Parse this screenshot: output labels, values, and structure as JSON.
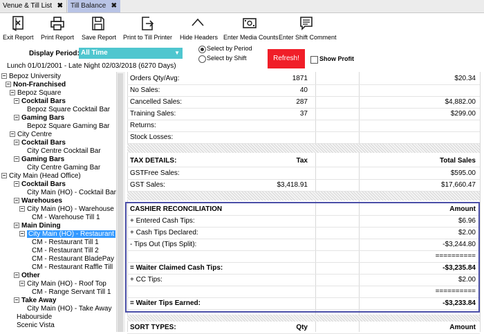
{
  "tabs": [
    {
      "label": "Venue & Till List",
      "close": "✖"
    },
    {
      "label": "Till Balance",
      "close": "✖"
    }
  ],
  "toolbar": {
    "items": [
      {
        "label": "Exit Report",
        "icon": "exit-report-icon"
      },
      {
        "label": "Print Report",
        "icon": "printer-icon"
      },
      {
        "label": "Save Report",
        "icon": "floppy-disk-icon"
      },
      {
        "label": "Print to Till Printer",
        "icon": "export-arrow-icon"
      },
      {
        "label": "Hide Headers",
        "icon": "chevron-up-icon"
      },
      {
        "label": "Enter Media Counts",
        "icon": "cash-note-icon"
      },
      {
        "label": "Enter Shift Comment",
        "icon": "comment-icon"
      }
    ]
  },
  "period": {
    "label": "Display Period:",
    "selected": "All Time",
    "radio_period": "Select by Period",
    "radio_shift": "Select by Shift",
    "refresh": "Refresh!",
    "show_profit": "Show Profit",
    "range_text": "Lunch 01/01/2001 - Late Night 02/03/2018 (6270 Days)"
  },
  "tree": [
    {
      "label": "Bepoz University",
      "bold": false
    },
    {
      "label": "Non-Franchised",
      "bold": true
    },
    {
      "label": "Bepoz Square",
      "bold": false
    },
    {
      "label": "Cocktail Bars",
      "bold": true
    },
    {
      "label": "Bepoz Square Cocktail Bar",
      "bold": false
    },
    {
      "label": "Gaming Bars",
      "bold": true
    },
    {
      "label": "Bepoz Square Gaming Bar",
      "bold": false
    },
    {
      "label": "City Centre",
      "bold": false
    },
    {
      "label": "Cocktail Bars",
      "bold": true
    },
    {
      "label": "City Centre Cocktail Bar",
      "bold": false
    },
    {
      "label": "Gaming Bars",
      "bold": true
    },
    {
      "label": "City Centre Gaming Bar",
      "bold": false
    },
    {
      "label": "City Main (Head Office)",
      "bold": false
    },
    {
      "label": "Cocktail Bars",
      "bold": true
    },
    {
      "label": "City Main (HO) - Cocktail Bar",
      "bold": false
    },
    {
      "label": "Warehouses",
      "bold": true
    },
    {
      "label": "City Main (HO) - Warehouse",
      "bold": false
    },
    {
      "label": "CM - Warehouse Till 1",
      "bold": false
    },
    {
      "label": "Main Dining",
      "bold": true
    },
    {
      "label": "City Main (HO) - Restaurant",
      "bold": false
    },
    {
      "label": "CM - Restaurant Till 1",
      "bold": false
    },
    {
      "label": "City Main (HO) - Restaurant",
      "bold": false
    },
    {
      "label": "CM - Restaurant BladePay",
      "bold": false
    },
    {
      "label": "CM - Restaurant Raffle Till",
      "bold": false
    },
    {
      "label": "Other",
      "bold": true
    },
    {
      "label": "City Main (HO) - Roof Top",
      "bold": false
    },
    {
      "label": "CM - Range Servant Till 1",
      "bold": false
    },
    {
      "label": "Take Away",
      "bold": true
    },
    {
      "label": "City Main (HO) - Take Away",
      "bold": false
    },
    {
      "label": "Habourside",
      "bold": false
    },
    {
      "label": "Scenic Vista",
      "bold": false
    }
  ],
  "tree_fixed": {
    "restaurant_till_2": "CM - Restaurant Till 2"
  },
  "report": {
    "orders": {
      "label": "Orders Qty/Avg:",
      "qty": "1871",
      "amount": "$20.34"
    },
    "no_sales": {
      "label": "No Sales:",
      "qty": "40",
      "amount": ""
    },
    "cancelled": {
      "label": "Cancelled Sales:",
      "qty": "287",
      "amount": "$4,882.00"
    },
    "training": {
      "label": "Training Sales:",
      "qty": "37",
      "amount": "$299.00"
    },
    "returns": {
      "label": "Returns:",
      "qty": "",
      "amount": ""
    },
    "stock_losses": {
      "label": "Stock Losses:",
      "qty": "",
      "amount": ""
    },
    "tax_header": {
      "label": "TAX DETAILS:",
      "qty": "Tax",
      "amount": "Total Sales"
    },
    "gstfree": {
      "label": "GSTFree Sales:",
      "qty": "",
      "amount": "$595.00"
    },
    "gst": {
      "label": "GST Sales:",
      "qty": "$3,418.91",
      "amount": "$17,660.47"
    },
    "recon_header": {
      "label": "CASHIER RECONCILIATION",
      "qty": "",
      "amount": "Amount"
    },
    "cash_tips": {
      "label": "+ Entered Cash Tips:",
      "amount": "$6.96"
    },
    "tips_declared": {
      "label": "+ Cash Tips Declared:",
      "amount": "$2.00"
    },
    "tips_out": {
      "label": "- Tips Out (Tips Split):",
      "amount": "-$3,244.80"
    },
    "sep1": "==========",
    "waiter_claimed": {
      "label": "= Waiter Claimed Cash Tips:",
      "amount": "-$3,235.84"
    },
    "cc_tips": {
      "label": "+ CC Tips:",
      "amount": "$2.00"
    },
    "sep2": "==========",
    "waiter_earned": {
      "label": "= Waiter Tips Earned:",
      "amount": "-$3,233.84"
    },
    "sort_header": {
      "label": "SORT TYPES:",
      "qty": "Qty",
      "amount": "Amount"
    }
  },
  "colors": {
    "tab_active": "#b9c4e6",
    "period_select": "#4fc6cf",
    "refresh": "#f01e28",
    "tree_selected": "#3399ff",
    "highlight_box": "#4b4fa8"
  }
}
